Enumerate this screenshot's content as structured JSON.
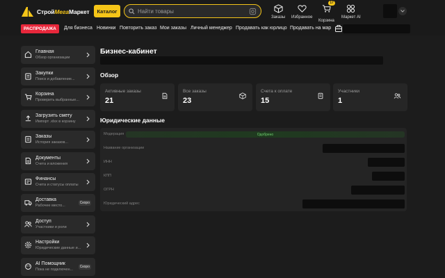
{
  "header": {
    "logo": "СтройМегаМаркет",
    "logo_part1": "Строй",
    "logo_part2": "Мега",
    "logo_part3": "Маркет",
    "catalog_label": "Каталог",
    "search_placeholder": "Найти товары",
    "icons": [
      {
        "name": "orders",
        "label": "Заказы",
        "icon": "box-icon"
      },
      {
        "name": "favorites",
        "label": "Избранное",
        "icon": "heart-icon"
      },
      {
        "name": "cart",
        "label": "Корзина",
        "icon": "cart-icon",
        "badge": "17"
      },
      {
        "name": "ai",
        "label": "Маркет AI",
        "icon": "ai-icon"
      }
    ]
  },
  "nav": {
    "sale": "РАСПРОДАЖА",
    "items": [
      "Для бизнеса",
      "Новинки",
      "Повторить заказ",
      "Мои заказы",
      "Личный менеджер",
      "Продавать как юрлицо",
      "Продавать на мар"
    ]
  },
  "sidebar": {
    "items": [
      {
        "title": "Главная",
        "subtitle": "Обзор организации",
        "icon": "home-icon"
      },
      {
        "title": "Закупки",
        "subtitle": "Поиск и добавление...",
        "icon": "clipboard-icon"
      },
      {
        "title": "Корзина",
        "subtitle": "Проверить выбранные...",
        "icon": "cart-icon"
      },
      {
        "title": "Загрузить смету",
        "subtitle": "Импорт .xlsx в корзину",
        "icon": "upload-icon"
      },
      {
        "title": "Заказы",
        "subtitle": "История заказов...",
        "icon": "list-icon"
      },
      {
        "title": "Документы",
        "subtitle": "Счета и вложения",
        "icon": "document-icon"
      },
      {
        "title": "Финансы",
        "subtitle": "Счета и статусы оплаты",
        "icon": "finance-icon"
      },
      {
        "title": "Доставка",
        "subtitle": "Рабочее место...",
        "icon": "truck-icon",
        "badge": "Скоро"
      },
      {
        "title": "Доступ",
        "subtitle": "Участники и роли",
        "icon": "users-icon"
      },
      {
        "title": "Настройки",
        "subtitle": "Юридические данные и...",
        "icon": "gear-icon"
      },
      {
        "title": "AI Помощник",
        "subtitle": "Пока не подключен...",
        "icon": "ai-icon",
        "badge": "Скоро"
      }
    ]
  },
  "main": {
    "title": "Бизнес-кабинет",
    "overview_title": "Обзор",
    "cards": [
      {
        "label": "Активные заказы",
        "value": "21",
        "icon": "document-icon"
      },
      {
        "label": "Все заказы",
        "value": "23",
        "icon": "box-icon"
      },
      {
        "label": "Счета к оплате",
        "value": "15",
        "icon": "receipt-icon"
      },
      {
        "label": "Участники",
        "value": "1",
        "icon": "users-icon"
      }
    ],
    "legal_title": "Юридические данные",
    "legal_rows": [
      {
        "label": "Модерация",
        "status": "Одобрено"
      },
      {
        "label": "Название организации"
      },
      {
        "label": "ИНН"
      },
      {
        "label": "КПП"
      },
      {
        "label": "ОГРН"
      },
      {
        "label": "Юридический адрес"
      }
    ]
  },
  "colors": {
    "accent": "#f5c518",
    "sale": "#e8273b",
    "approved": "#6fd06f"
  }
}
